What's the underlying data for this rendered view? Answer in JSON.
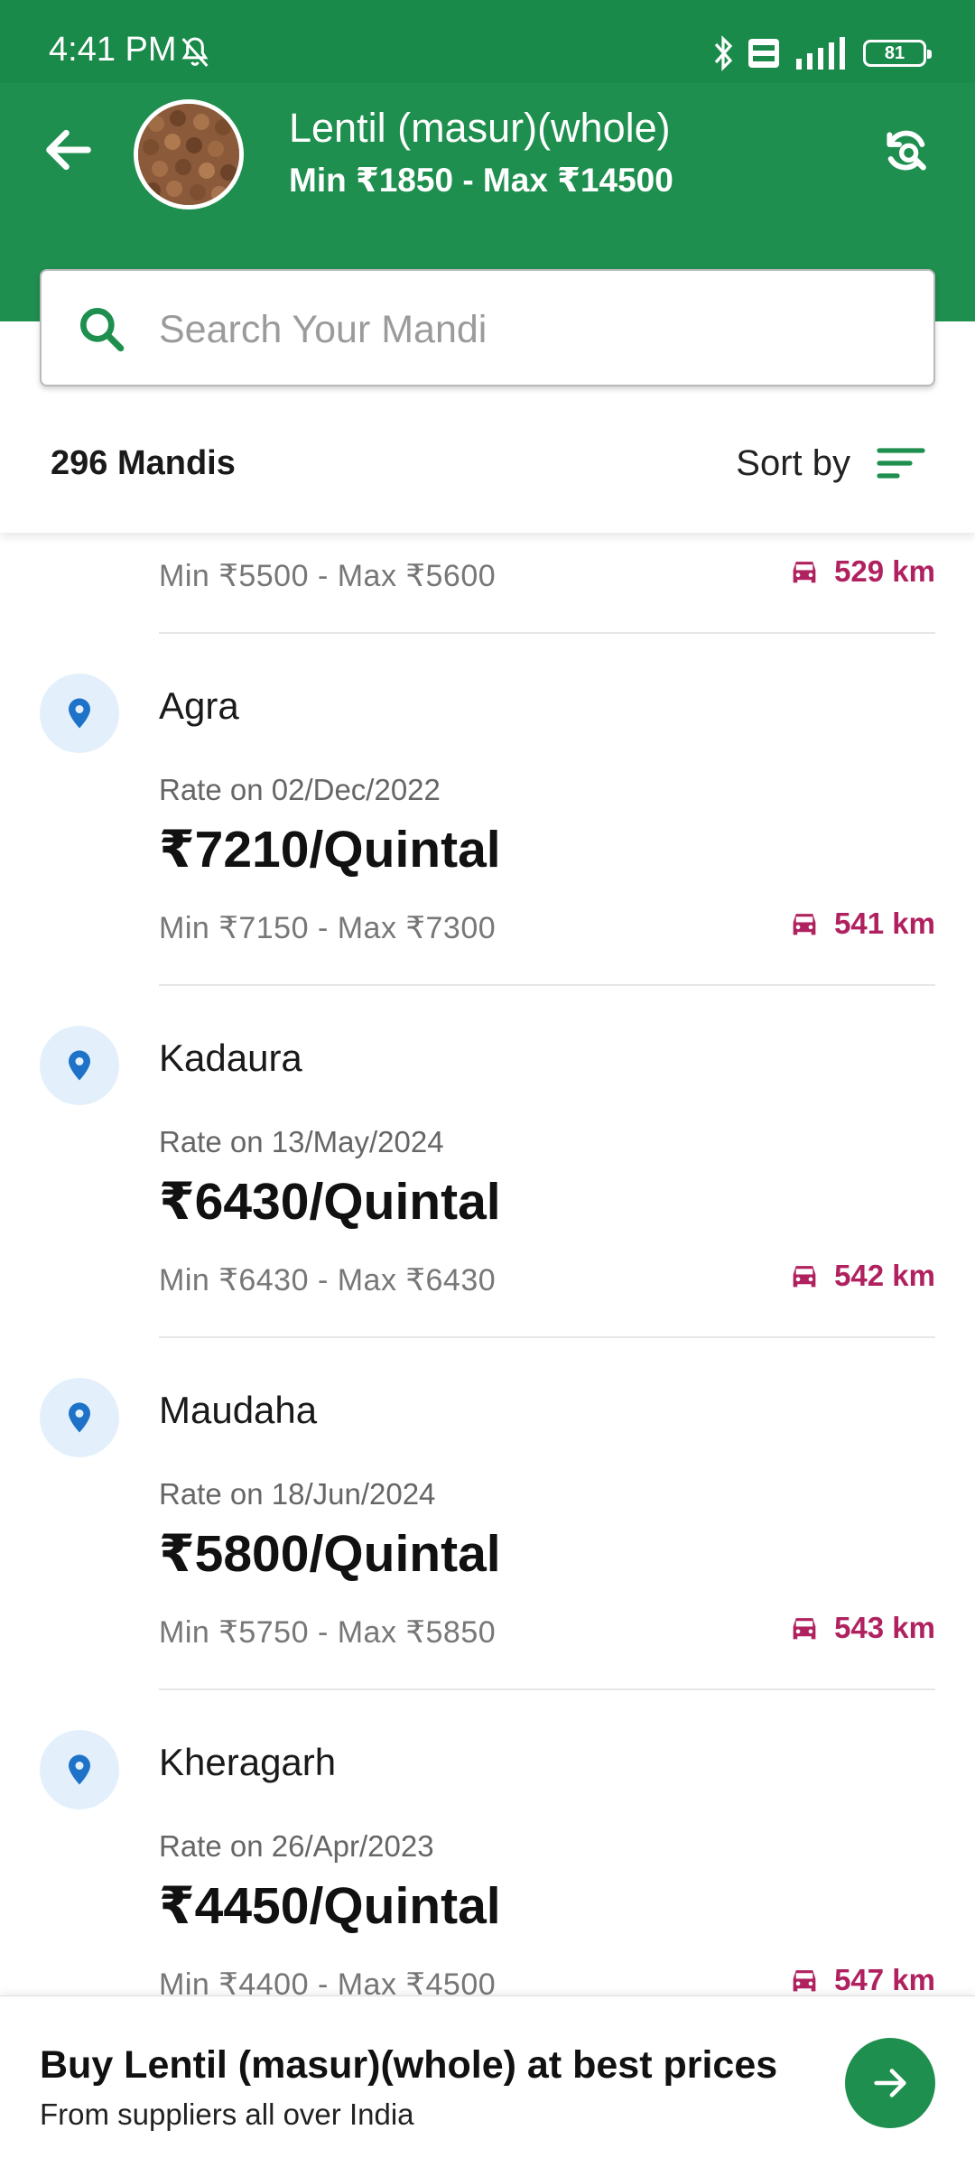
{
  "status_bar": {
    "time": "4:41 PM",
    "battery": "81"
  },
  "header": {
    "title": "Lentil (masur)(whole)",
    "subtitle": "Min ₹1850 - Max ₹14500"
  },
  "search": {
    "placeholder": "Search Your Mandi"
  },
  "list_header": {
    "count": "296 Mandis",
    "sort_label": "Sort by"
  },
  "partial_row": {
    "range": "Min ₹5500 - Max ₹5600",
    "distance": "529 km"
  },
  "mandis": [
    {
      "name": "Agra",
      "date": "Rate on 02/Dec/2022",
      "price": "₹7210/Quintal",
      "range": "Min ₹7150 - Max ₹7300",
      "distance": "541 km"
    },
    {
      "name": "Kadaura",
      "date": "Rate on 13/May/2024",
      "price": "₹6430/Quintal",
      "range": "Min ₹6430 - Max ₹6430",
      "distance": "542 km"
    },
    {
      "name": "Maudaha",
      "date": "Rate on 18/Jun/2024",
      "price": "₹5800/Quintal",
      "range": "Min ₹5750 - Max ₹5850",
      "distance": "543 km"
    },
    {
      "name": "Kheragarh",
      "date": "Rate on 26/Apr/2023",
      "price": "₹4450/Quintal",
      "range": "Min ₹4400 - Max ₹4500",
      "distance": "547 km"
    }
  ],
  "banner": {
    "title": "Buy Lentil (masur)(whole) at best prices",
    "subtitle": "From suppliers all over India"
  },
  "colors": {
    "header": "#1e8f4e",
    "distance": "#b0225f",
    "pin": "#1e73c8"
  }
}
